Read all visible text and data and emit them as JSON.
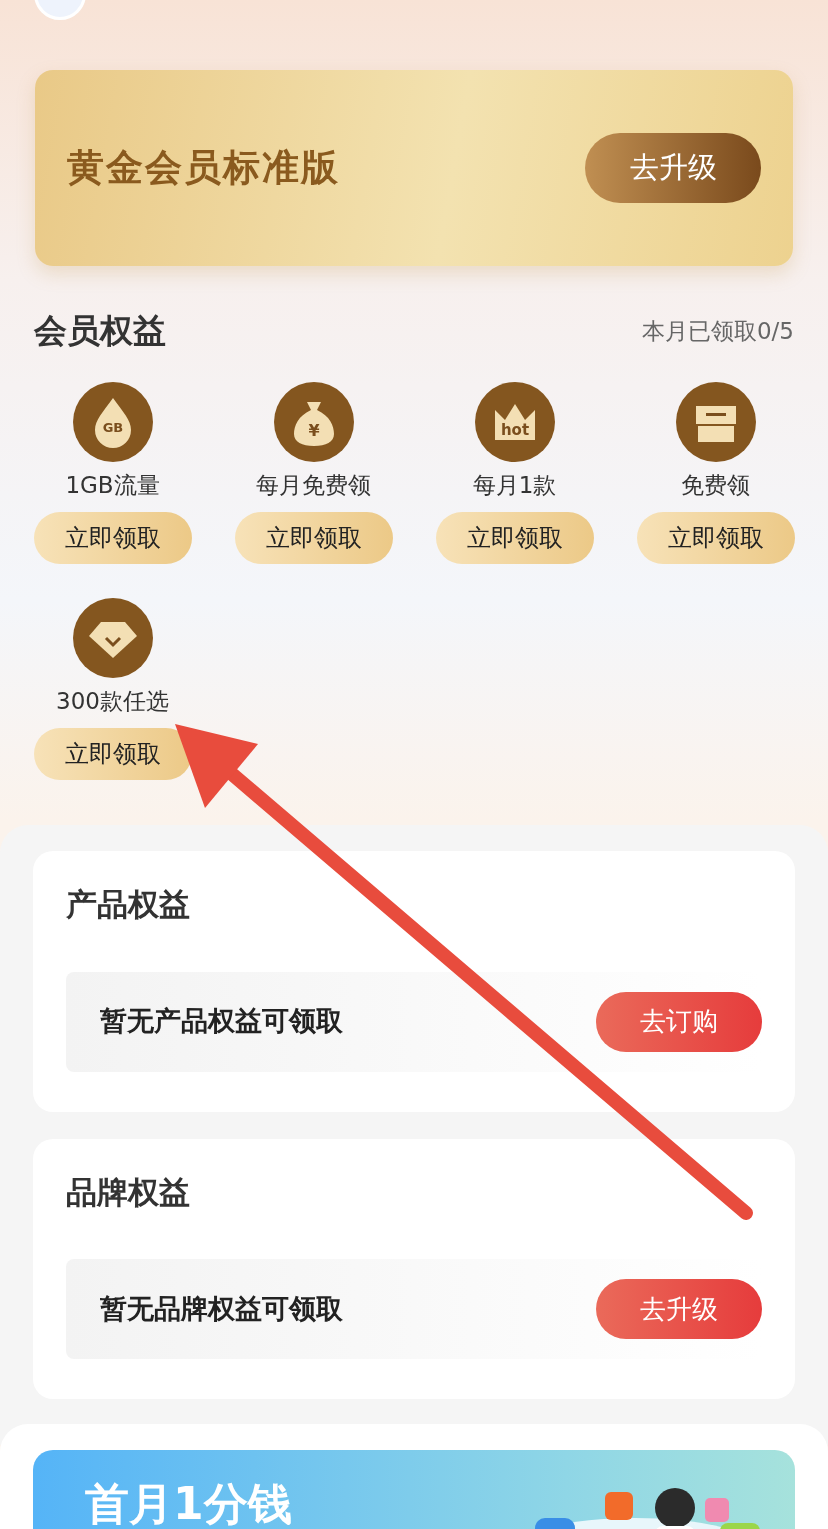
{
  "membership_card": {
    "title": "黄金会员标准版",
    "button": "去升级"
  },
  "benefits": {
    "title": "会员权益",
    "progress": "本月已领取0/5",
    "items": [
      {
        "kind": "drop",
        "icon_text": "GB",
        "label": "1GB流量",
        "button": "立即领取"
      },
      {
        "kind": "moneybag",
        "icon_text": "¥",
        "label": "每月免费领",
        "button": "立即领取"
      },
      {
        "kind": "crown",
        "icon_text": "hot",
        "label": "每月1款",
        "button": "立即领取"
      },
      {
        "kind": "shop",
        "label": "免费领",
        "button": "立即领取"
      },
      {
        "kind": "diamond",
        "label": "300款任选",
        "button": "立即领取"
      }
    ]
  },
  "sections": [
    {
      "title": "产品权益",
      "message": "暂无产品权益可领取",
      "button": "去订购"
    },
    {
      "title": "品牌权益",
      "message": "暂无品牌权益可领取",
      "button": "去升级"
    }
  ],
  "promo_banner": {
    "title": "首月1分钱"
  }
}
